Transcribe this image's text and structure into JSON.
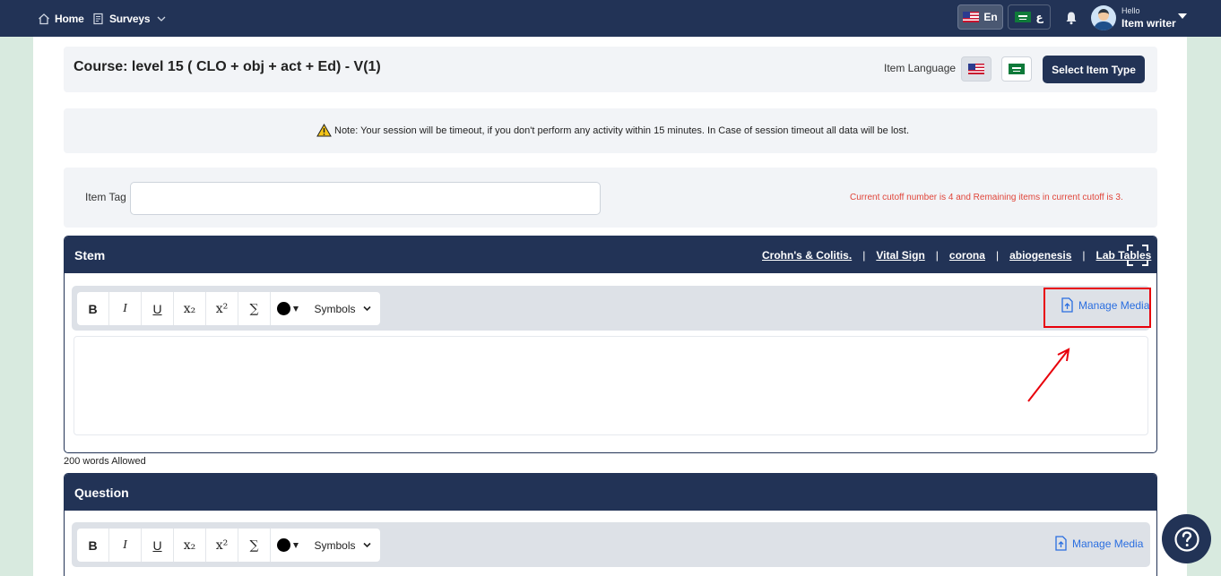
{
  "nav": {
    "home": "Home",
    "surveys": "Surveys",
    "lang_en": "En",
    "lang_ar": "ع",
    "greeting": "Hello",
    "user": "Item writer"
  },
  "course": {
    "title": "Course:  level 15 ( CLO + obj + act + Ed) - V(1)",
    "item_language_label": "Item Language",
    "select_item_type": "Select Item Type"
  },
  "note": "Note: Your session will be timeout, if you don't perform any activity within 15 minutes. In Case of session timeout all data will be lost.",
  "item_tag": {
    "label": "Item Tag",
    "value": "",
    "cutoff_text": "Current cutoff number is 4 and Remaining items in current cutoff is 3."
  },
  "stem": {
    "title": "Stem",
    "links": [
      "Crohn's & Colitis.",
      "Vital Sign",
      "corona",
      "abiogenesis",
      "Lab Tables"
    ],
    "manage_media": "Manage Media",
    "words_allowed": "200 words Allowed"
  },
  "question": {
    "title": "Question",
    "manage_media": "Manage Media"
  },
  "toolbar": {
    "bold": "B",
    "italic": "I",
    "underline": "U",
    "subscript": "x₂",
    "superscript": "x²",
    "sum": "∑",
    "symbols": "Symbols"
  },
  "colors": {
    "navy": "#223356",
    "accent_link": "#2a6ee0",
    "highlight": "#e8000b",
    "cutoff_text": "#e0453a"
  }
}
